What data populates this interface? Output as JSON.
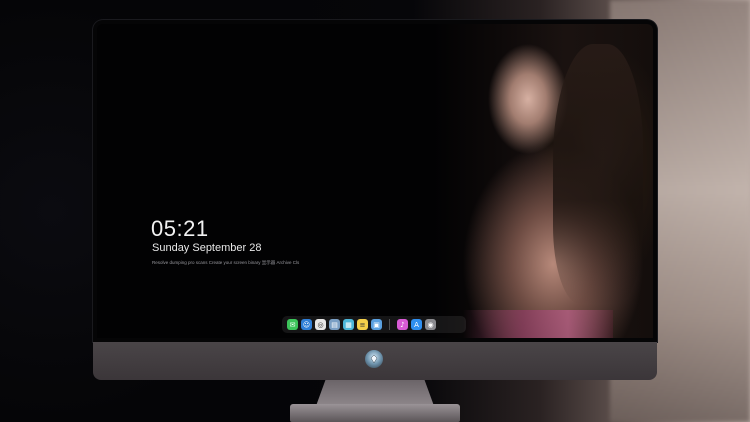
{
  "lockscreen": {
    "time": "05:21",
    "date": "Sunday September  28",
    "subline": "Resolve dumping pro scans  Create your screen binary 显示器  Archive Cls"
  },
  "dock": {
    "apps": [
      {
        "name": "messages-icon",
        "glyph": "✉",
        "color": "#3cc45a"
      },
      {
        "name": "finder-icon",
        "glyph": "☺",
        "color": "#2f7fd8"
      },
      {
        "name": "safari-icon",
        "glyph": "◎",
        "color": "#e6e6e6"
      },
      {
        "name": "preview-icon",
        "glyph": "▤",
        "color": "#7a9fc4"
      },
      {
        "name": "clapper-icon",
        "glyph": "▦",
        "color": "#4cb7d9"
      },
      {
        "name": "notes-icon",
        "glyph": "≡",
        "color": "#f4d04a"
      },
      {
        "name": "photos-icon",
        "glyph": "▣",
        "color": "#5aa0e0"
      },
      {
        "name": "music-icon",
        "glyph": "♪",
        "color": "#d95bd6"
      },
      {
        "name": "appstore-icon",
        "glyph": "A",
        "color": "#2f8ff0"
      },
      {
        "name": "camera-icon",
        "glyph": "◉",
        "color": "#8a8a8e"
      }
    ]
  },
  "colors": {
    "screen_bg": "#020203",
    "chin": "#4a4548",
    "clock_text": "#f2f2f2"
  }
}
